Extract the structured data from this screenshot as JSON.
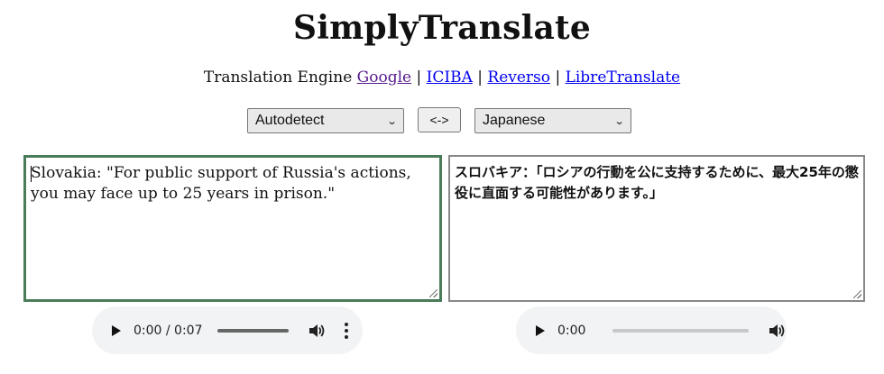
{
  "title": "SimplyTranslate",
  "engines": {
    "label": "Translation Engine",
    "items": [
      "Google",
      "ICIBA",
      "Reverso",
      "LibreTranslate"
    ],
    "separator": "|"
  },
  "source_lang": {
    "selected": "Autodetect"
  },
  "target_lang": {
    "selected": "Japanese"
  },
  "swap_label": "<->",
  "input_text": "Slovakia: \"For public support of Russia's actions, you may face up to 25 years in prison.\"",
  "output_text": "スロバキア：「ロシアの行動を公に支持するために、最大25年の懲役に直面する可能性があります。」",
  "audio_source": {
    "time": "0:00 / 0:07"
  },
  "audio_target": {
    "time": "0:00"
  },
  "colors": {
    "input_border": "#4a7c59",
    "link": "#0000ee",
    "visited_link": "#551a8b",
    "audio_bg": "#f1f3f4"
  }
}
